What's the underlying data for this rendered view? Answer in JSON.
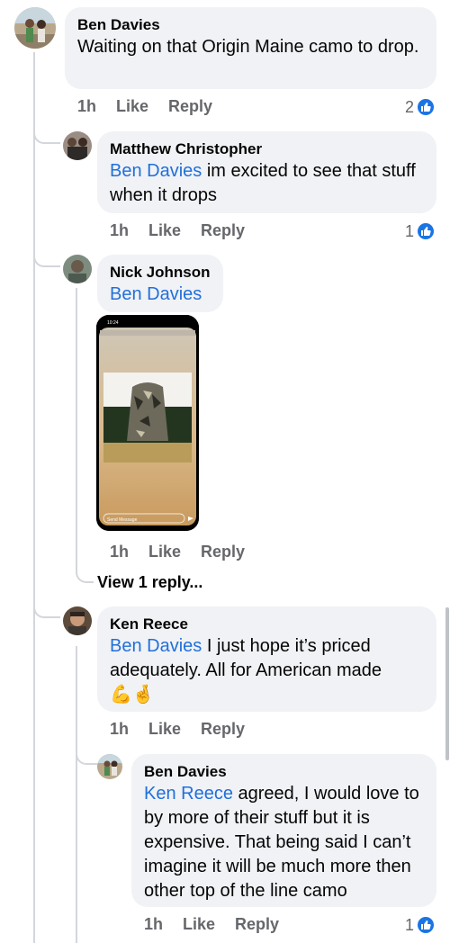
{
  "comments": [
    {
      "author": "Ben Davies",
      "text": "Waiting on that Origin Maine camo to drop.",
      "time": "1h",
      "like_label": "Like",
      "reply_label": "Reply",
      "like_count": "2"
    },
    {
      "author": "Matthew Christopher",
      "mention": "Ben Davies",
      "text": " im excited to see that stuff when it drops",
      "time": "1h",
      "like_label": "Like",
      "reply_label": "Reply",
      "like_count": "1"
    },
    {
      "author": "Nick Johnson",
      "mention": "Ben Davies",
      "time": "1h",
      "like_label": "Like",
      "reply_label": "Reply",
      "attachment": {
        "status_time": "10:24",
        "send_message": "Send Message"
      }
    },
    {
      "author": "Ken Reece",
      "mention": "Ben Davies",
      "text": " I just hope it’s priced adequately. All for American made",
      "emoji": "💪🤞",
      "time": "1h",
      "like_label": "Like",
      "reply_label": "Reply"
    },
    {
      "author": "Ben Davies",
      "mention": "Ken Reece",
      "text": " agreed, I would love to by more of their stuff but it is expensive. That being said I can’t imagine it will be much more then other top of the line camo",
      "time": "1h",
      "like_label": "Like",
      "reply_label": "Reply",
      "like_count": "1"
    }
  ],
  "view_replies_label": "View 1 reply...",
  "colors": {
    "mention": "#216fdb",
    "bubble": "#f0f2f5",
    "like_badge": "#1b74e4",
    "meta": "#65676b"
  }
}
